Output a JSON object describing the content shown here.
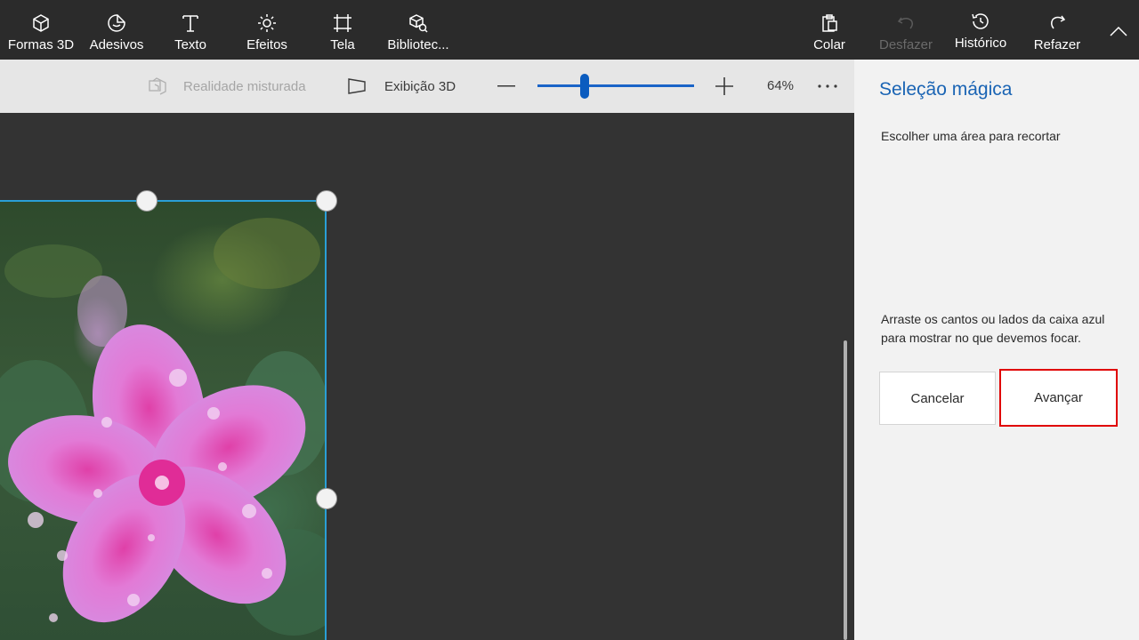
{
  "toolbar": {
    "tools": [
      {
        "label": "Formas 3D",
        "icon": "cube-icon"
      },
      {
        "label": "Adesivos",
        "icon": "sticker-icon"
      },
      {
        "label": "Texto",
        "icon": "text-icon"
      },
      {
        "label": "Efeitos",
        "icon": "sun-icon"
      },
      {
        "label": "Tela",
        "icon": "canvas-icon"
      },
      {
        "label": "Bibliotec...",
        "icon": "library-icon"
      }
    ],
    "paste_label": "Colar",
    "undo_label": "Desfazer",
    "history_label": "Histórico",
    "redo_label": "Refazer"
  },
  "subbar": {
    "mixed_reality_label": "Realidade misturada",
    "view3d_label": "Exibição 3D",
    "zoom_value": "64%",
    "zoom_fraction": 0.3
  },
  "panel": {
    "title": "Seleção mágica",
    "subtitle": "Escolher uma área para recortar",
    "instructions": "Arraste os cantos ou lados da caixa azul para mostrar no que devemos focar.",
    "cancel_label": "Cancelar",
    "next_label": "Avançar"
  },
  "colors": {
    "accent": "#1a64b4",
    "selection_border": "#2a9fd6",
    "highlight": "#e00000"
  }
}
